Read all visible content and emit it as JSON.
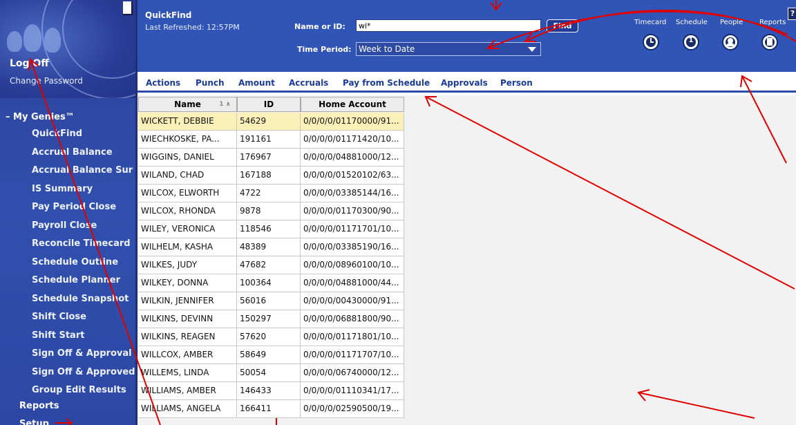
{
  "sidebar": {
    "logoff": "Log Off",
    "change_password": "Change Password",
    "section_title": "– My Genies™",
    "items": [
      {
        "label": "QuickFind"
      },
      {
        "label": "Accrual Balance"
      },
      {
        "label": "Accrual Balance Sur"
      },
      {
        "label": "IS Summary"
      },
      {
        "label": "Pay Period Close"
      },
      {
        "label": "Payroll Close"
      },
      {
        "label": "Reconcile Timecard"
      },
      {
        "label": "Schedule Outline"
      },
      {
        "label": "Schedule Planner"
      },
      {
        "label": "Schedule Snapshot"
      },
      {
        "label": "Shift Close"
      },
      {
        "label": "Shift Start"
      },
      {
        "label": "Sign Off & Approval"
      },
      {
        "label": "Sign Off & Approved"
      },
      {
        "label": "Group Edit Results"
      }
    ],
    "reports": "Reports",
    "setup": "Setup"
  },
  "header": {
    "title": "QuickFind",
    "last_refreshed": "Last Refreshed: 12:57PM",
    "name_label": "Name or ID:",
    "name_value": "wi*",
    "find_label": "Find",
    "time_period_label": "Time Period:",
    "time_period_value": "Week to Date",
    "links": [
      "Timecard",
      "Schedule",
      "People",
      "Reports"
    ],
    "help": "?"
  },
  "menu": [
    "Actions",
    "Punch",
    "Amount",
    "Accruals",
    "Pay from Schedule",
    "Approvals",
    "Person"
  ],
  "table": {
    "columns": [
      "Name",
      "ID",
      "Home Account"
    ],
    "sort_indicator": "1 ∧",
    "rows": [
      [
        "WICKETT, DEBBIE",
        "54629",
        "0/0/0/0/01170000/91..."
      ],
      [
        "WIECHKOSKE, PA...",
        "191161",
        "0/0/0/0/01171420/10..."
      ],
      [
        "WIGGINS, DANIEL",
        "176967",
        "0/0/0/0/04881000/12..."
      ],
      [
        "WILAND, CHAD",
        "167188",
        "0/0/0/0/01520102/63..."
      ],
      [
        "WILCOX, ELWORTH",
        "4722",
        "0/0/0/0/03385144/16..."
      ],
      [
        "WILCOX, RHONDA",
        "9878",
        "0/0/0/0/01170300/90..."
      ],
      [
        "WILEY, VERONICA",
        "118546",
        "0/0/0/0/01171701/10..."
      ],
      [
        "WILHELM, KASHA",
        "48389",
        "0/0/0/0/03385190/16..."
      ],
      [
        "WILKES, JUDY",
        "47682",
        "0/0/0/0/08960100/10..."
      ],
      [
        "WILKEY, DONNA",
        "100364",
        "0/0/0/0/04881000/44..."
      ],
      [
        "WILKIN, JENNIFER",
        "56016",
        "0/0/0/0/00430000/91..."
      ],
      [
        "WILKINS, DEVINN",
        "150297",
        "0/0/0/0/06881800/90..."
      ],
      [
        "WILKINS, REAGEN",
        "57620",
        "0/0/0/0/01171801/10..."
      ],
      [
        "WILLCOX, AMBER",
        "58649",
        "0/0/0/0/01171707/10..."
      ],
      [
        "WILLEMS, LINDA",
        "50054",
        "0/0/0/0/06740000/12..."
      ],
      [
        "WILLIAMS, AMBER",
        "146433",
        "0/0/0/0/01110341/17..."
      ],
      [
        "WILLIAMS, ANGELA",
        "166411",
        "0/0/0/0/02590500/19..."
      ]
    ]
  },
  "colors": {
    "accent": "#3155b6",
    "sidebar": "#2f4aa8",
    "selected_row": "#fbf0b8",
    "annotation": "#e00000"
  }
}
